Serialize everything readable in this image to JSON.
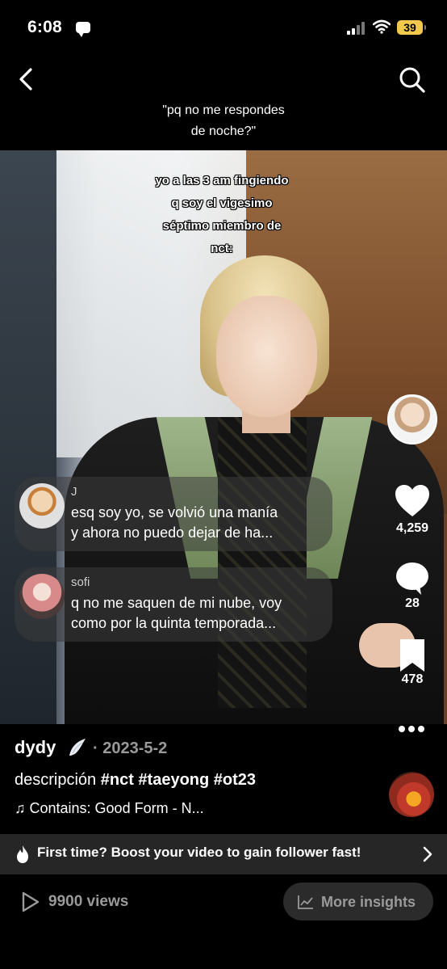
{
  "status_bar": {
    "time": "6:08",
    "battery": "39"
  },
  "header": {
    "caption_lines": [
      "\"pq no me respondes",
      "de noche?\""
    ]
  },
  "video": {
    "overlay_lines": [
      "yo a las 3 am fingiendo",
      "q soy el vigesimo",
      "séptimo miembro de",
      "nct:"
    ]
  },
  "comments": [
    {
      "user": "J",
      "lines": [
        "esq soy yo, se volvió una manía",
        "y ahora no puedo dejar de ha..."
      ]
    },
    {
      "user": "sofi",
      "lines": [
        "q no me saquen de mi nube, voy",
        "como por la quinta temporada..."
      ]
    }
  ],
  "actions": {
    "likes": "4,259",
    "comments": "28",
    "saves": "478"
  },
  "post": {
    "username": "dydy",
    "date": "· 2023-5-2",
    "description_prefix": "descripción",
    "hashtags": "#nct #taeyong #ot23",
    "music": "♫ Contains: Good Form - N..."
  },
  "boost": {
    "text": "First time? Boost your video to gain follower fast!"
  },
  "footer": {
    "views": "9900 views",
    "insights": "More insights"
  },
  "colors": {
    "background": "#000000",
    "muted": "#9a9a9a",
    "bar": "#262626",
    "battery": "#f2c94c"
  }
}
